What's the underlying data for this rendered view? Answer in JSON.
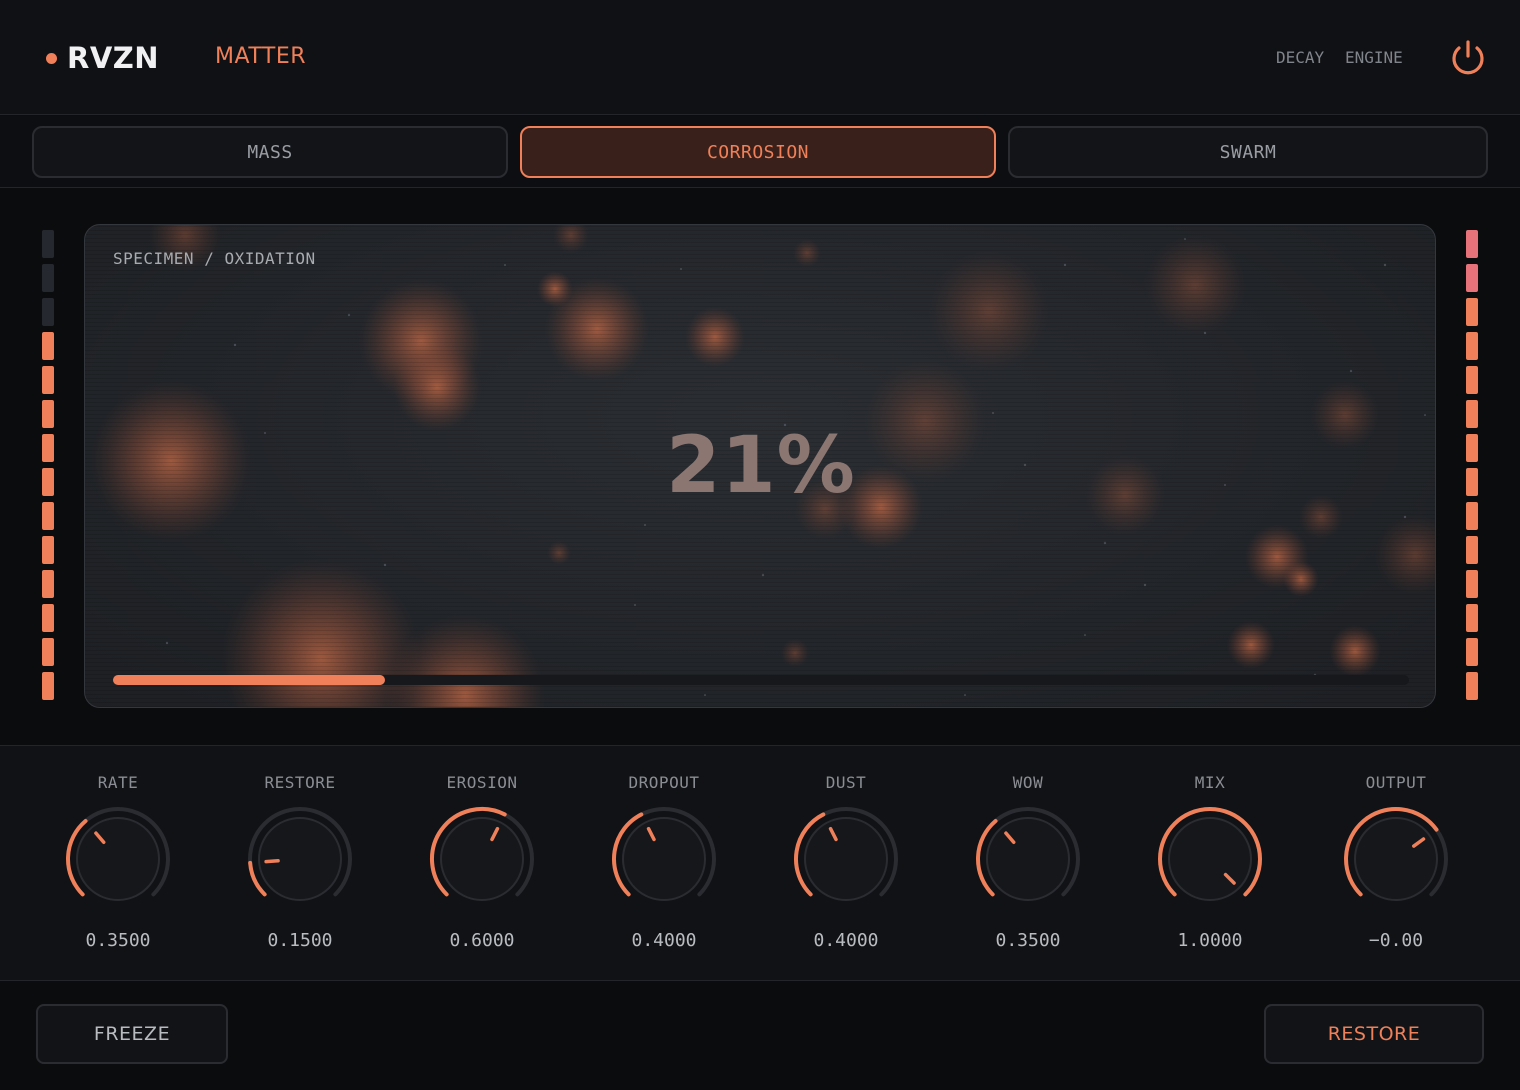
{
  "header": {
    "brand": "RVZN",
    "preset": "MATTER",
    "links": [
      "DECAY",
      "ENGINE"
    ],
    "power_icon": "power-icon",
    "accent": "#ef8059"
  },
  "tabs": [
    {
      "label": "MASS",
      "active": false
    },
    {
      "label": "CORROSION",
      "active": true
    },
    {
      "label": "SWARM",
      "active": false
    }
  ],
  "display": {
    "label": "SPECIMEN / OXIDATION",
    "percent_text": "21%",
    "progress": 0.21
  },
  "meters": {
    "left_lit_segments": 11,
    "right_lit_segments": 14,
    "right_peak_segments": 2,
    "total_segments": 14
  },
  "knobs": [
    {
      "label": "RATE",
      "value": "0.3500",
      "level": 0.35
    },
    {
      "label": "RESTORE",
      "value": "0.1500",
      "level": 0.15
    },
    {
      "label": "EROSION",
      "value": "0.6000",
      "level": 0.6
    },
    {
      "label": "DROPOUT",
      "value": "0.4000",
      "level": 0.4
    },
    {
      "label": "DUST",
      "value": "0.4000",
      "level": 0.4
    },
    {
      "label": "WOW",
      "value": "0.3500",
      "level": 0.35
    },
    {
      "label": "MIX",
      "value": "1.0000",
      "level": 1.0
    },
    {
      "label": "OUTPUT",
      "value": "−0.00",
      "level": 0.7
    }
  ],
  "footer": {
    "freeze": "FREEZE",
    "restore": "RESTORE"
  }
}
